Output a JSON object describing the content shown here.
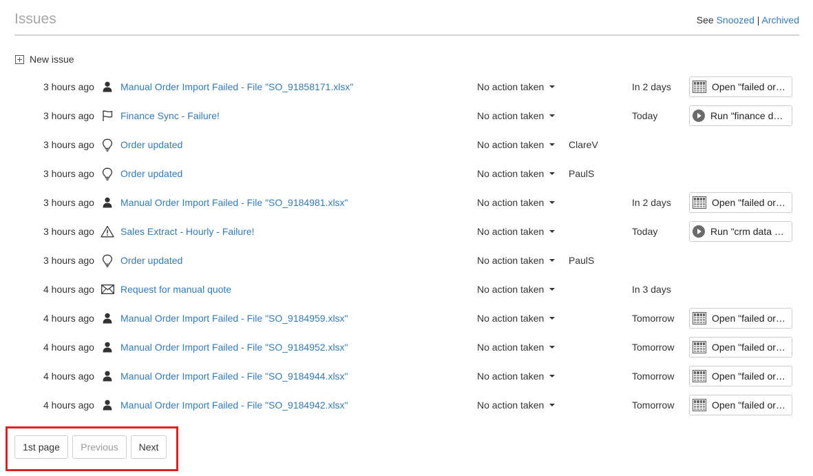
{
  "header": {
    "title": "Issues",
    "see_prefix": "See",
    "snoozed": "Snoozed",
    "separator": "|",
    "archived": "Archived"
  },
  "new_issue_label": "New issue",
  "issues": [
    {
      "time": "3 hours ago",
      "icon": "person-icon",
      "title": "Manual Order Import Failed - File \"SO_91858171.xlsx\"",
      "status": "No action taken",
      "assignee": "",
      "due": "In 2 days",
      "action": "Open \"failed orders\"",
      "action_icon": "table-icon"
    },
    {
      "time": "3 hours ago",
      "icon": "flag-icon",
      "title": "Finance Sync - Failure!",
      "status": "No action taken",
      "assignee": "",
      "due": "Today",
      "action": "Run \"finance data sync\"",
      "action_icon": "play-icon"
    },
    {
      "time": "3 hours ago",
      "icon": "lightbulb-icon",
      "title": "Order updated",
      "status": "No action taken",
      "assignee": "ClareV",
      "due": "",
      "action": "",
      "action_icon": ""
    },
    {
      "time": "3 hours ago",
      "icon": "lightbulb-icon",
      "title": "Order updated",
      "status": "No action taken",
      "assignee": "PaulS",
      "due": "",
      "action": "",
      "action_icon": ""
    },
    {
      "time": "3 hours ago",
      "icon": "person-icon",
      "title": "Manual Order Import Failed - File \"SO_9184981.xlsx\"",
      "status": "No action taken",
      "assignee": "",
      "due": "In 2 days",
      "action": "Open \"failed orders\"",
      "action_icon": "table-icon"
    },
    {
      "time": "3 hours ago",
      "icon": "warning-icon",
      "title": "Sales Extract - Hourly - Failure!",
      "status": "No action taken",
      "assignee": "",
      "due": "Today",
      "action": "Run \"crm data extract\"",
      "action_icon": "play-icon"
    },
    {
      "time": "3 hours ago",
      "icon": "lightbulb-icon",
      "title": "Order updated",
      "status": "No action taken",
      "assignee": "PaulS",
      "due": "",
      "action": "",
      "action_icon": ""
    },
    {
      "time": "4 hours ago",
      "icon": "envelope-icon",
      "title": "Request for manual quote",
      "status": "No action taken",
      "assignee": "",
      "due": "In 3 days",
      "action": "",
      "action_icon": ""
    },
    {
      "time": "4 hours ago",
      "icon": "person-icon",
      "title": "Manual Order Import Failed - File \"SO_9184959.xlsx\"",
      "status": "No action taken",
      "assignee": "",
      "due": "Tomorrow",
      "action": "Open \"failed orders\"",
      "action_icon": "table-icon"
    },
    {
      "time": "4 hours ago",
      "icon": "person-icon",
      "title": "Manual Order Import Failed - File \"SO_9184952.xlsx\"",
      "status": "No action taken",
      "assignee": "",
      "due": "Tomorrow",
      "action": "Open \"failed orders\"",
      "action_icon": "table-icon"
    },
    {
      "time": "4 hours ago",
      "icon": "person-icon",
      "title": "Manual Order Import Failed - File \"SO_9184944.xlsx\"",
      "status": "No action taken",
      "assignee": "",
      "due": "Tomorrow",
      "action": "Open \"failed orders\"",
      "action_icon": "table-icon"
    },
    {
      "time": "4 hours ago",
      "icon": "person-icon",
      "title": "Manual Order Import Failed - File \"SO_9184942.xlsx\"",
      "status": "No action taken",
      "assignee": "",
      "due": "Tomorrow",
      "action": "Open \"failed orders\"",
      "action_icon": "table-icon"
    }
  ],
  "pagination": {
    "first": "1st page",
    "previous": "Previous",
    "next": "Next",
    "previous_disabled": true,
    "highlight_color": "#dd2222"
  },
  "colors": {
    "link": "#337ab7",
    "title": "#a6a6a6"
  }
}
